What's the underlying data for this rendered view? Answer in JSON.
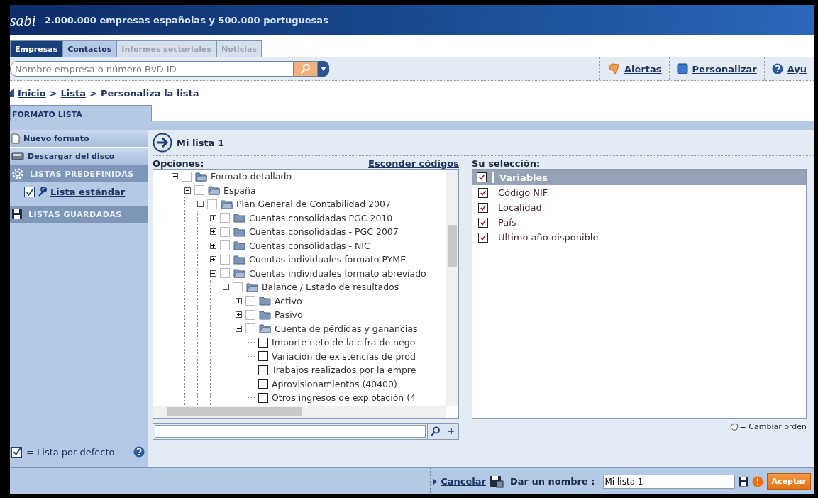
{
  "header": {
    "logo": "sabi",
    "tagline": "2.000.000 empresas españolas y 500.000 portuguesas"
  },
  "tabs": [
    {
      "label": "Empresas",
      "selected": true,
      "disabled": false
    },
    {
      "label": "Contactos",
      "selected": false,
      "disabled": false
    },
    {
      "label": "Informes sectoriales",
      "selected": false,
      "disabled": true
    },
    {
      "label": "Noticias",
      "selected": false,
      "disabled": true
    }
  ],
  "search": {
    "placeholder": "Nombre empresa o número BvD ID"
  },
  "toolbar_links": [
    {
      "label": "Alertas",
      "kind": "alert"
    },
    {
      "label": "Personalizar",
      "kind": "customize"
    },
    {
      "label": "Ayu",
      "kind": "help"
    }
  ],
  "breadcrumb": [
    {
      "label": "Inicio",
      "kind": "link"
    },
    {
      "label": ">",
      "kind": "separator"
    },
    {
      "label": "Lista",
      "kind": "link"
    },
    {
      "label": ">",
      "kind": "separator"
    },
    {
      "label": "Personaliza la lista",
      "kind": "current"
    }
  ],
  "section_tab": "FORMATO LISTA",
  "sidebar": {
    "actions": [
      {
        "label": "Nuevo formato",
        "kind": "new"
      },
      {
        "label": "Descargar del disco",
        "kind": "disk"
      }
    ],
    "groups": [
      {
        "title": "LISTAS PREDEFINIDAS",
        "kind": "gear",
        "items": [
          {
            "label": "Lista estándar",
            "checked": true
          }
        ]
      },
      {
        "title": "LISTAS GUARDADAS",
        "kind": "save"
      }
    ],
    "legend": "= Lista por defecto"
  },
  "list_title": "Mi lista 1",
  "options": {
    "label": "Opciones:",
    "toggle": "Esconder códigos",
    "tree": [
      {
        "label": "Formato detallado",
        "expanded": true,
        "checked": false,
        "children": [
          {
            "label": "España",
            "expanded": true,
            "checked": false,
            "children": [
              {
                "label": "Plan General de Contabilidad 2007",
                "expanded": true,
                "checked": false,
                "children": [
                  {
                    "label": "Cuentas consolidadas PGC 2010",
                    "expanded": false,
                    "checked": false
                  },
                  {
                    "label": "Cuentas consolidadas - PGC 2007",
                    "expanded": false,
                    "checked": false
                  },
                  {
                    "label": "Cuentas consolidadas - NIC",
                    "expanded": false,
                    "checked": false
                  },
                  {
                    "label": "Cuentas individuales formato PYME",
                    "expanded": false,
                    "checked": false
                  },
                  {
                    "label": "Cuentas individuales formato abreviado",
                    "expanded": true,
                    "checked": false,
                    "children": [
                      {
                        "label": "Balance / Estado de resultados",
                        "expanded": true,
                        "checked": false,
                        "children": [
                          {
                            "label": "Activo",
                            "expanded": false,
                            "checked": false
                          },
                          {
                            "label": "Pasivo",
                            "expanded": false,
                            "checked": false
                          },
                          {
                            "label": "Cuenta de pérdidas y ganancias",
                            "expanded": true,
                            "checked": false,
                            "children": [
                              {
                                "label": "Importe neto de la cifra de nego",
                                "checked": false
                              },
                              {
                                "label": "Variación de existencias de prod",
                                "checked": false
                              },
                              {
                                "label": "Trabajos realizados por la empre",
                                "checked": false
                              },
                              {
                                "label": "Aprovisionamientos (40400)",
                                "checked": false
                              },
                              {
                                "label": "Otros ingresos de explotación (4",
                                "checked": false
                              }
                            ]
                          }
                        ]
                      }
                    ]
                  }
                ]
              }
            ]
          }
        ]
      }
    ]
  },
  "selection": {
    "label": "Su selección:",
    "header": "Variables",
    "header_checked": true,
    "items": [
      {
        "label": "Código NIF",
        "checked": true
      },
      {
        "label": "Localidad",
        "checked": true
      },
      {
        "label": "País",
        "checked": true
      },
      {
        "label": "Ultimo año disponible",
        "checked": true
      }
    ],
    "reorder_hint": "= Cambiar orden"
  },
  "footer": {
    "cancel": "Cancelar",
    "name_label": "Dar un nombre :",
    "name_value": "Mi lista 1",
    "accept": "Aceptar"
  }
}
